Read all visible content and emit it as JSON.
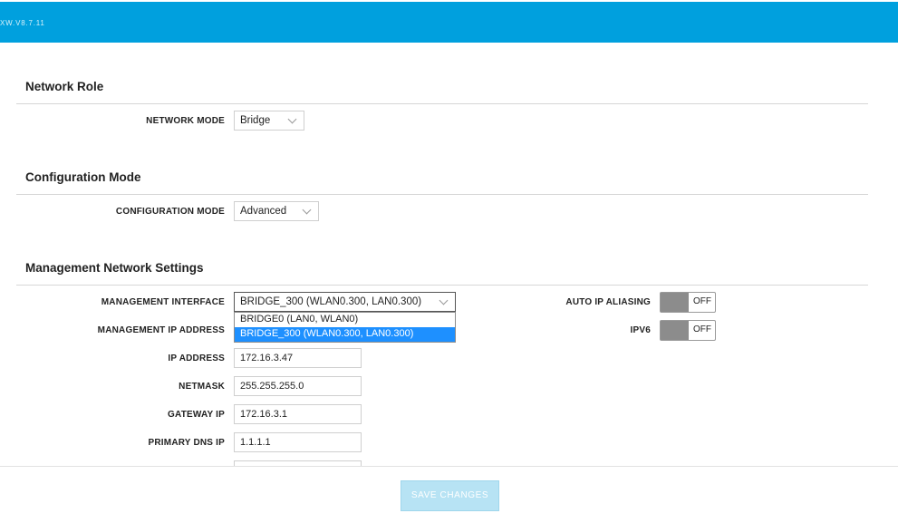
{
  "header": {
    "version": "XW.V8.7.11",
    "bar_color": "#00a0de"
  },
  "sections": {
    "network_role": {
      "title": "Network Role",
      "network_mode_label": "NETWORK MODE",
      "network_mode_value": "Bridge"
    },
    "configuration_mode": {
      "title": "Configuration Mode",
      "configuration_mode_label": "CONFIGURATION MODE",
      "configuration_mode_value": "Advanced"
    },
    "management": {
      "title": "Management Network Settings",
      "interface_label": "MANAGEMENT INTERFACE",
      "interface_value": "BRIDGE_300 (WLAN0.300, LAN0.300)",
      "interface_options": [
        "BRIDGE0 (LAN0, WLAN0)",
        "BRIDGE_300 (WLAN0.300, LAN0.300)"
      ],
      "ip_address_mode_label": "MANAGEMENT IP ADDRESS",
      "ip_address_label": "IP ADDRESS",
      "ip_address_value": "172.16.3.47",
      "netmask_label": "NETMASK",
      "netmask_value": "255.255.255.0",
      "gateway_label": "GATEWAY IP",
      "gateway_value": "172.16.3.1",
      "primary_dns_label": "PRIMARY DNS IP",
      "primary_dns_value": "1.1.1.1",
      "auto_ip_aliasing_label": "AUTO IP ALIASING",
      "auto_ip_aliasing_state": "OFF",
      "ipv6_label": "IPV6",
      "ipv6_state": "OFF"
    }
  },
  "footer": {
    "save_label": "SAVE CHANGES"
  }
}
